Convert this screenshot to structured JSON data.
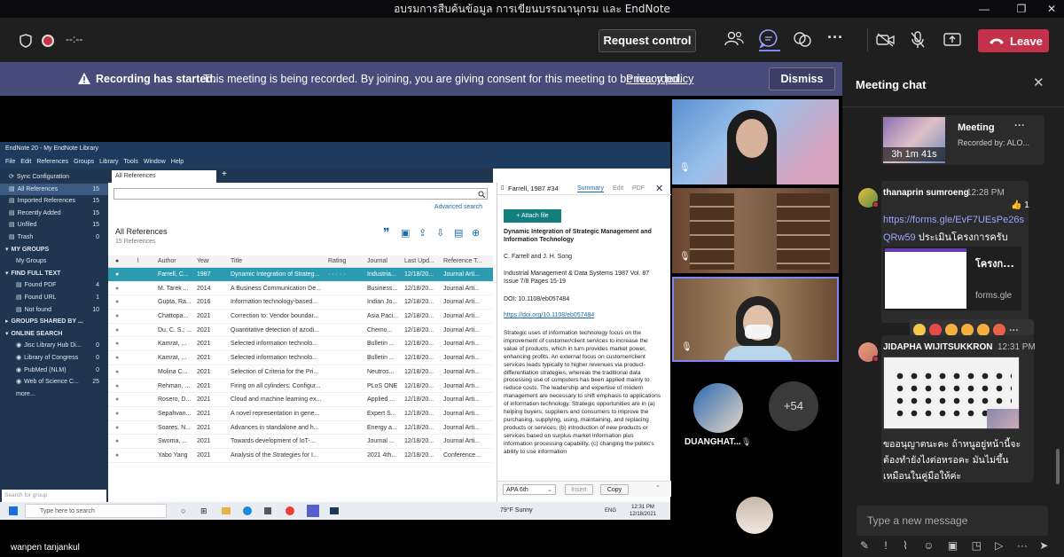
{
  "window": {
    "title": "อบรมการสืบค้นข้อมูล การเขียนบรรณานุกรม และ EndNote",
    "minimize": "—",
    "maximize": "❐",
    "close": "✕"
  },
  "meeting": {
    "timer": "--:--",
    "request_control": "Request control",
    "leave": "Leave"
  },
  "banner": {
    "title": "Recording has started.",
    "message": "This meeting is being recorded. By joining, you are giving consent for this meeting to be recorded.",
    "link": "Privacy policy",
    "dismiss": "Dismiss"
  },
  "endnote": {
    "title": "EndNote 20 - My EndNote Library",
    "menu": [
      "File",
      "Edit",
      "References",
      "Groups",
      "Library",
      "Tools",
      "Window",
      "Help"
    ],
    "sync": "Sync Configuration",
    "groups": [
      {
        "label": "All References",
        "count": "15",
        "sel": true
      },
      {
        "label": "Imported References",
        "count": "15"
      },
      {
        "label": "Recently Added",
        "count": "15"
      },
      {
        "label": "Unfiled",
        "count": "15"
      },
      {
        "label": "Trash",
        "count": "0"
      }
    ],
    "my_groups_header": "MY GROUPS",
    "my_groups": "My Groups",
    "find_header": "FIND FULL TEXT",
    "find": [
      {
        "label": "Found PDF",
        "count": "4"
      },
      {
        "label": "Found URL",
        "count": "1"
      },
      {
        "label": "Not found",
        "count": "10"
      }
    ],
    "shared_header": "GROUPS SHARED BY ...",
    "online_header": "ONLINE SEARCH",
    "online": [
      {
        "label": "Jisc Library Hub Di...",
        "count": "0"
      },
      {
        "label": "Library of Congress",
        "count": "0"
      },
      {
        "label": "PubMed (NLM)",
        "count": "0"
      },
      {
        "label": "Web of Science C...",
        "count": "25"
      }
    ],
    "more": "more...",
    "search_group": "Search for group",
    "tab": "All References",
    "advanced": "Advanced search",
    "list_title": "All References",
    "list_count": "15 References",
    "columns": [
      "Author",
      "Year",
      "Title",
      "Rating",
      "Journal",
      "Last Upd...",
      "Reference T..."
    ],
    "rows": [
      {
        "author": "Farrell, C...",
        "year": "1987",
        "title": "Dynamic Integration of Strateg...",
        "rating": "· · · · ·",
        "journal": "Industria...",
        "updated": "12/18/20...",
        "type": "Journal Arti...",
        "sel": true
      },
      {
        "author": "M. Tarek ...",
        "year": "2014",
        "title": "A Business Communication De...",
        "journal": "Business...",
        "updated": "12/18/20...",
        "type": "Journal Arti..."
      },
      {
        "author": "Gupta, Ra...",
        "year": "2016",
        "title": "Information technology-based...",
        "journal": "Indian Jo...",
        "updated": "12/18/20...",
        "type": "Journal Arti..."
      },
      {
        "author": "Chattopa...",
        "year": "2021",
        "title": "Correction to: Vendor boundar...",
        "journal": "Asia Paci...",
        "updated": "12/18/20...",
        "type": "Journal Arti..."
      },
      {
        "author": "Du, C. S.; ...",
        "year": "2021",
        "title": "Quantitative detection of azodi...",
        "journal": "Chemo...",
        "updated": "12/18/20...",
        "type": "Journal Arti..."
      },
      {
        "author": "Kamrat, ...",
        "year": "2021",
        "title": "Selected information technolo...",
        "journal": "Bulletin ...",
        "updated": "12/18/20...",
        "type": "Journal Arti..."
      },
      {
        "author": "Kamrat, ...",
        "year": "2021",
        "title": "Selected information technolo...",
        "journal": "Bulletin ...",
        "updated": "12/18/20...",
        "type": "Journal Arti..."
      },
      {
        "author": "Molina C...",
        "year": "2021",
        "title": "Selection of Criteria for the Pri...",
        "journal": "Neutros...",
        "updated": "12/18/20...",
        "type": "Journal Arti..."
      },
      {
        "author": "Rehman, ...",
        "year": "2021",
        "title": "Firing on all cylinders: Configur...",
        "journal": "PLoS ONE",
        "updated": "12/18/20...",
        "type": "Journal Arti..."
      },
      {
        "author": "Rosero, D...",
        "year": "2021",
        "title": "Cloud and machine learning ex...",
        "journal": "Applied ...",
        "updated": "12/18/20...",
        "type": "Journal Arti..."
      },
      {
        "author": "Sepahvan...",
        "year": "2021",
        "title": "A novel representation in gene...",
        "journal": "Expert S...",
        "updated": "12/18/20...",
        "type": "Journal Arti..."
      },
      {
        "author": "Soares, N...",
        "year": "2021",
        "title": "Advances in standalone and h...",
        "journal": "Energy a...",
        "updated": "12/18/20...",
        "type": "Journal Arti..."
      },
      {
        "author": "Swoma, ...",
        "year": "2021",
        "title": "Towards development of IoT-...",
        "journal": "Journal ...",
        "updated": "12/18/20...",
        "type": "Journal Arti..."
      },
      {
        "author": "Yabo Yang",
        "year": "2021",
        "title": "Analysis of the Strategies for I...",
        "journal": "2021 4th...",
        "updated": "12/18/20...",
        "type": "Conference..."
      }
    ],
    "detail": {
      "header": "Farrell, 1987 #34",
      "tabs": [
        "Summary",
        "Edit",
        "PDF"
      ],
      "attach": "+ Attach file",
      "title": "Dynamic Integration of Strategic Management and Information Technology",
      "authors": "C. Farrell and J. H. Song",
      "source": "Industrial Management & Data Systems 1987 Vol. 87 Issue 7/8 Pages 15-19",
      "doi": "DOI: 10.1108/eb057484",
      "url": "https://doi.org/10.1108/eb057484",
      "abstract": "Strategic uses of information technology focus on the improvement of customer/client services to increase the value of products, which in turn provides market power, enhancing profits. An external focus on customer/client services leads typically to higher revenues via product-differentiation strategies, whereas the traditional data processing use of computers has been applied mainly to reduce costs. The leadership and expertise of modern management are necessary to shift emphasis to applications of information technology. Strategic opportunities are in (a) helping buyers, suppliers and consumers to improve the purchasing, supplying, using, maintaining, and replacing products or services, (b) introduction of new products or services based on surplus market information plus information processing capability, (c) changing the public's ability to use information",
      "style": "APA 6th",
      "insert": "Insert",
      "copy": "Copy"
    },
    "taskbar": {
      "search": "Type here to search",
      "weather": "79°F Sunny",
      "lang": "ENG",
      "time": "12:31 PM",
      "date": "12/18/2021"
    }
  },
  "participants": {
    "name1": "DUANGHAT...",
    "more": "+54",
    "presenter": "wanpen tanjankul"
  },
  "chat": {
    "title": "Meeting chat",
    "recording": {
      "title": "Meeting",
      "by": "Recorded by: ALO...",
      "duration": "3h 1m 41s"
    },
    "msg1": {
      "name": "thanaprin sumroeng",
      "time": "12:28 PM",
      "reaction_count": "1",
      "link_a": "https://forms.gle/EvF7UEsPe26s",
      "link_b": "QRw59",
      "text": "ประเมินโครงการครับ",
      "card_title": "โครงก...",
      "card_domain": "forms.gle"
    },
    "msg2": {
      "name": "JIDAPHA WIJITSUKKRON",
      "time": "12:31 PM",
      "text_a": "ขออนุญาตนะคะ ถ้าหนูอยู่หน้านี้จะ",
      "text_b": "ต้องทำยังไงต่อหรอคะ มันไม่ขึ้น",
      "text_c": "เหมือนในคู่มือให้ค่ะ"
    },
    "placeholder": "Type a new message"
  }
}
